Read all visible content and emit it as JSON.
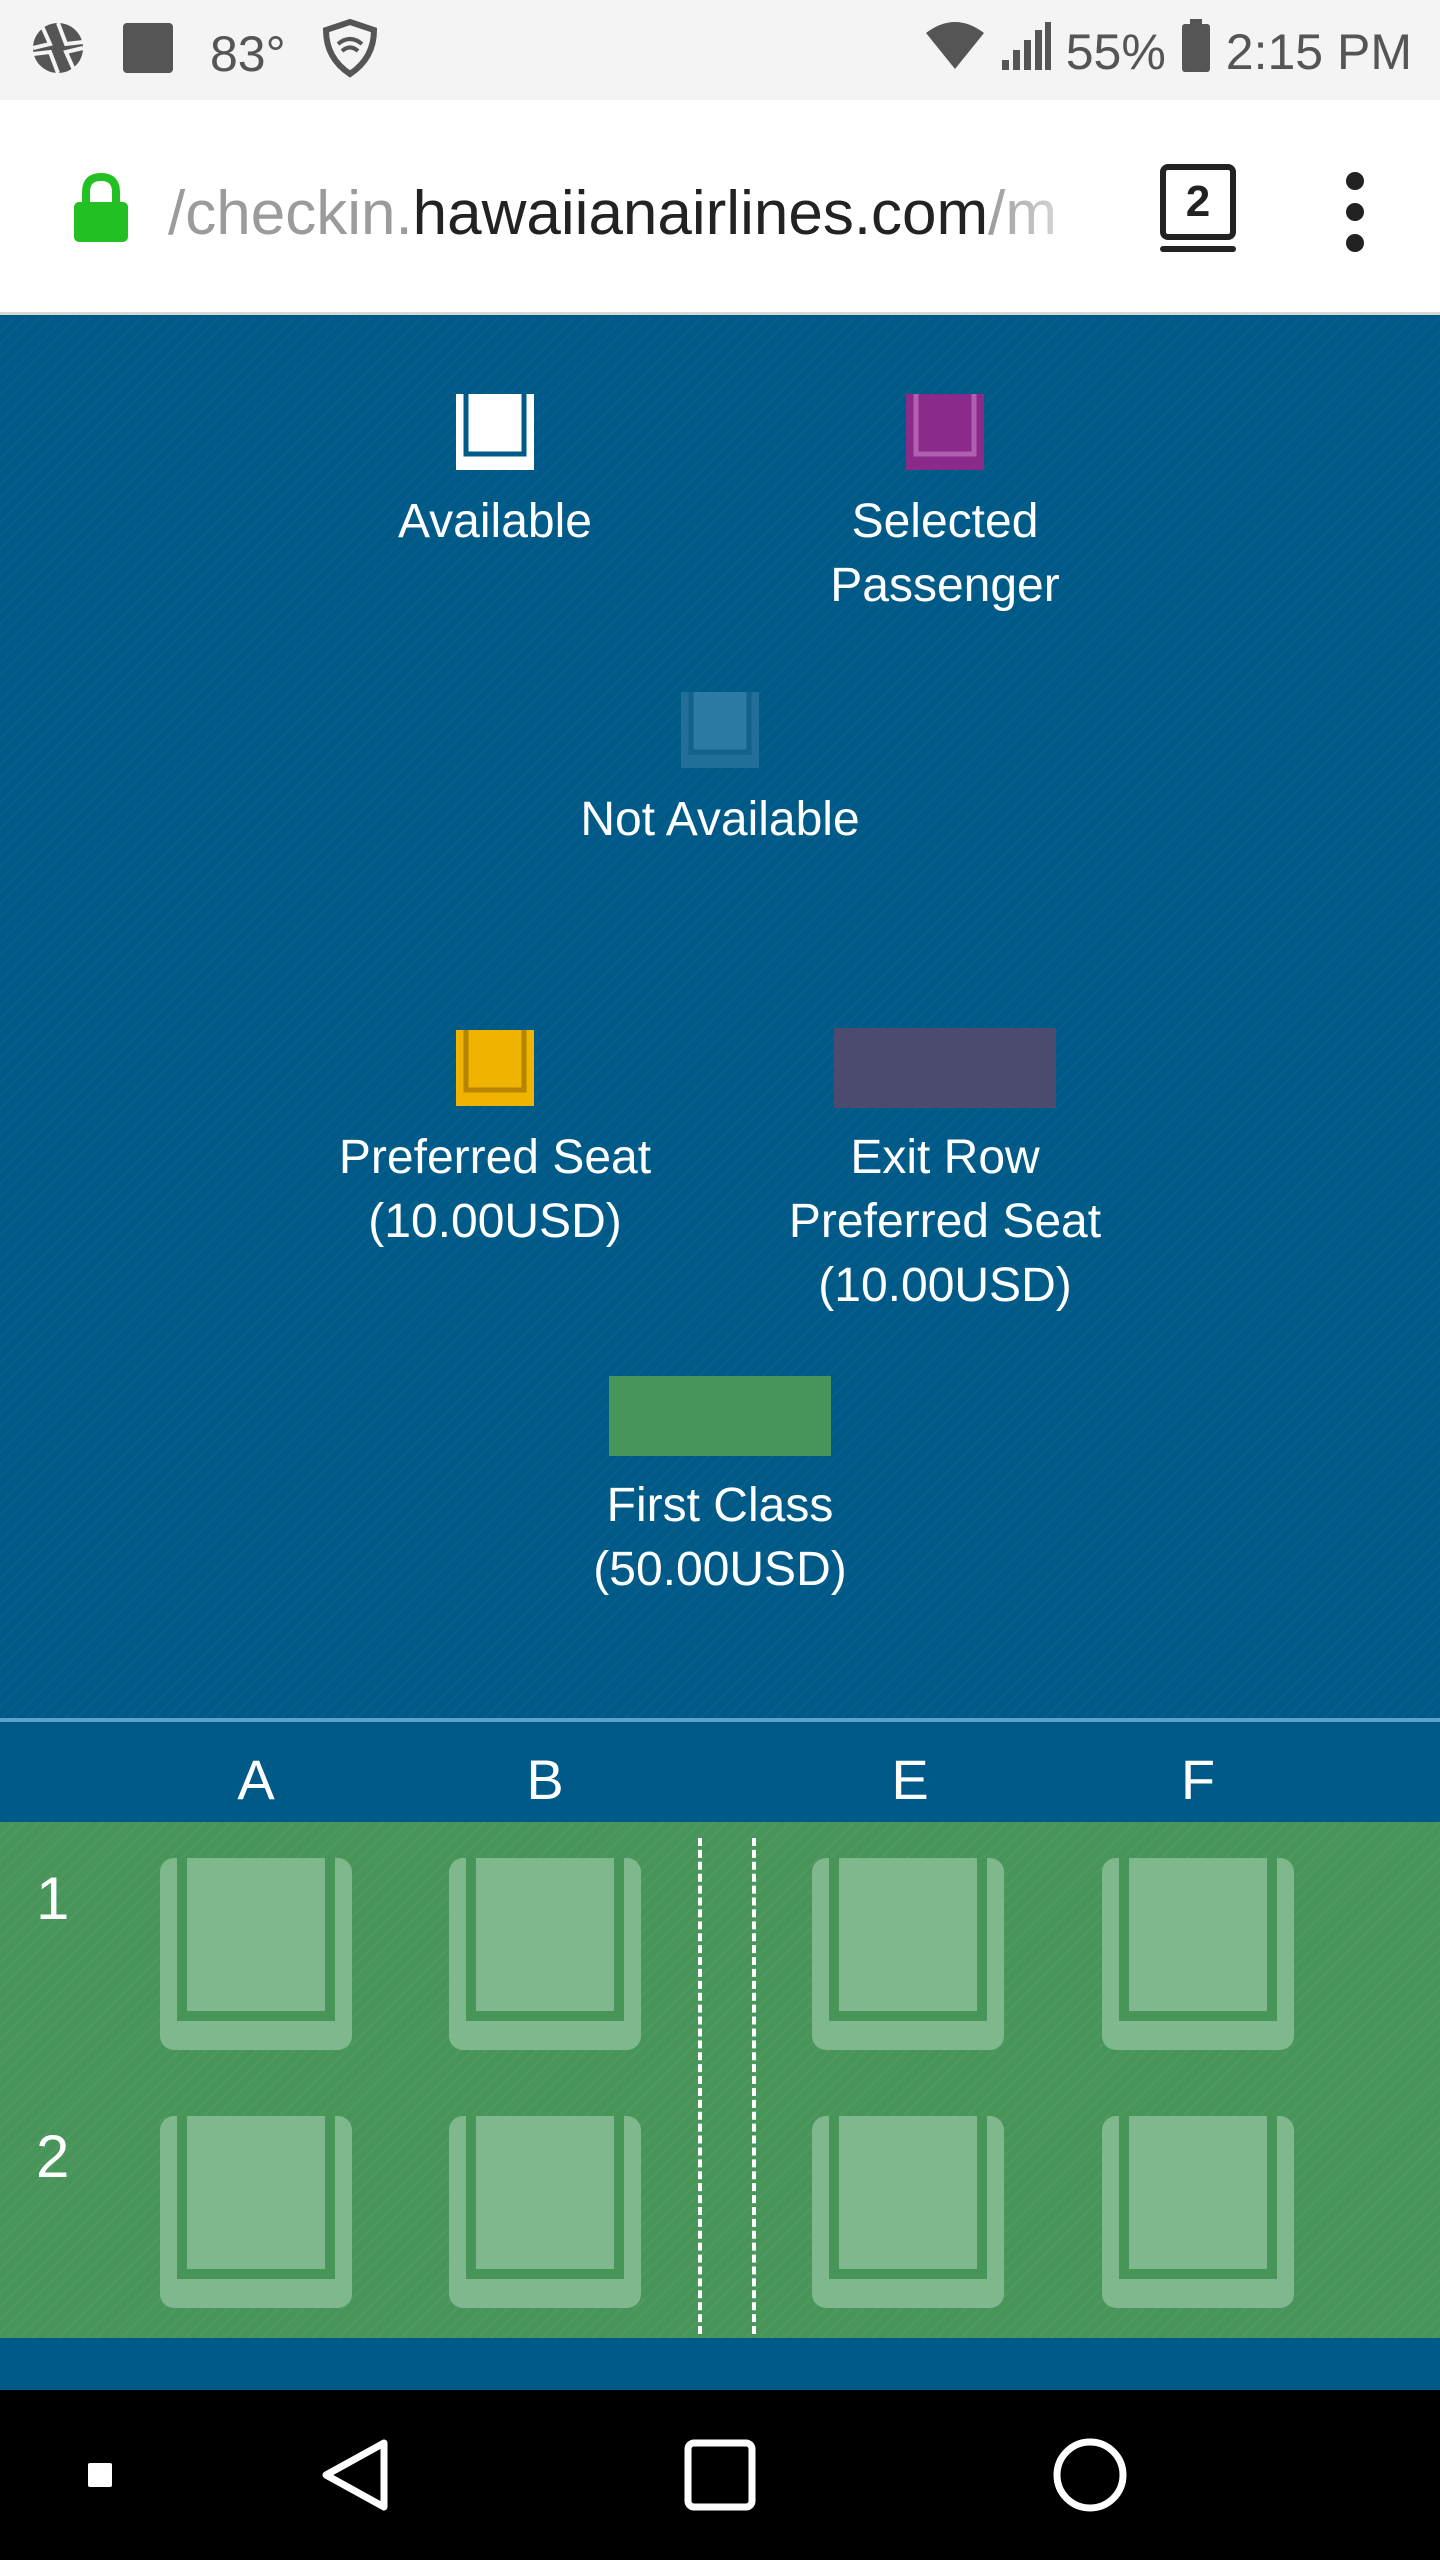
{
  "status_bar": {
    "temperature": "83°",
    "battery": "55%",
    "time": "2:15 PM",
    "icons": [
      "aperture-icon",
      "square-icon",
      "shield-icon",
      "wifi-icon",
      "signal-icon",
      "battery-icon"
    ]
  },
  "browser": {
    "url_prefix": "/checkin.",
    "url_domain": "hawaiianairlines.com",
    "url_suffix": "/m",
    "tab_count": "2",
    "secure_color": "#22c022"
  },
  "legend": {
    "available": "Available",
    "selected_line1": "Selected",
    "selected_line2": "Passenger",
    "not_available": "Not Available",
    "preferred_line1": "Preferred Seat",
    "preferred_line2": "(10.00USD)",
    "exit_line1": "Exit Row",
    "exit_line2": "Preferred Seat",
    "exit_line3": "(10.00USD)",
    "first_line1": "First Class",
    "first_line2": "(50.00USD)"
  },
  "colors": {
    "background": "#005a88",
    "available": "#ffffff",
    "selected": "#8a2a8a",
    "preferred": "#f0b400",
    "exit_row": "#4b4a6f",
    "first_class": "#48955a"
  },
  "seat_map": {
    "columns": [
      "A",
      "B",
      "E",
      "F"
    ],
    "rows": [
      {
        "label": "1",
        "seats": [
          "1A",
          "1B",
          "1E",
          "1F"
        ]
      },
      {
        "label": "2",
        "seats": [
          "2A",
          "2B",
          "2E",
          "2F"
        ]
      }
    ]
  }
}
